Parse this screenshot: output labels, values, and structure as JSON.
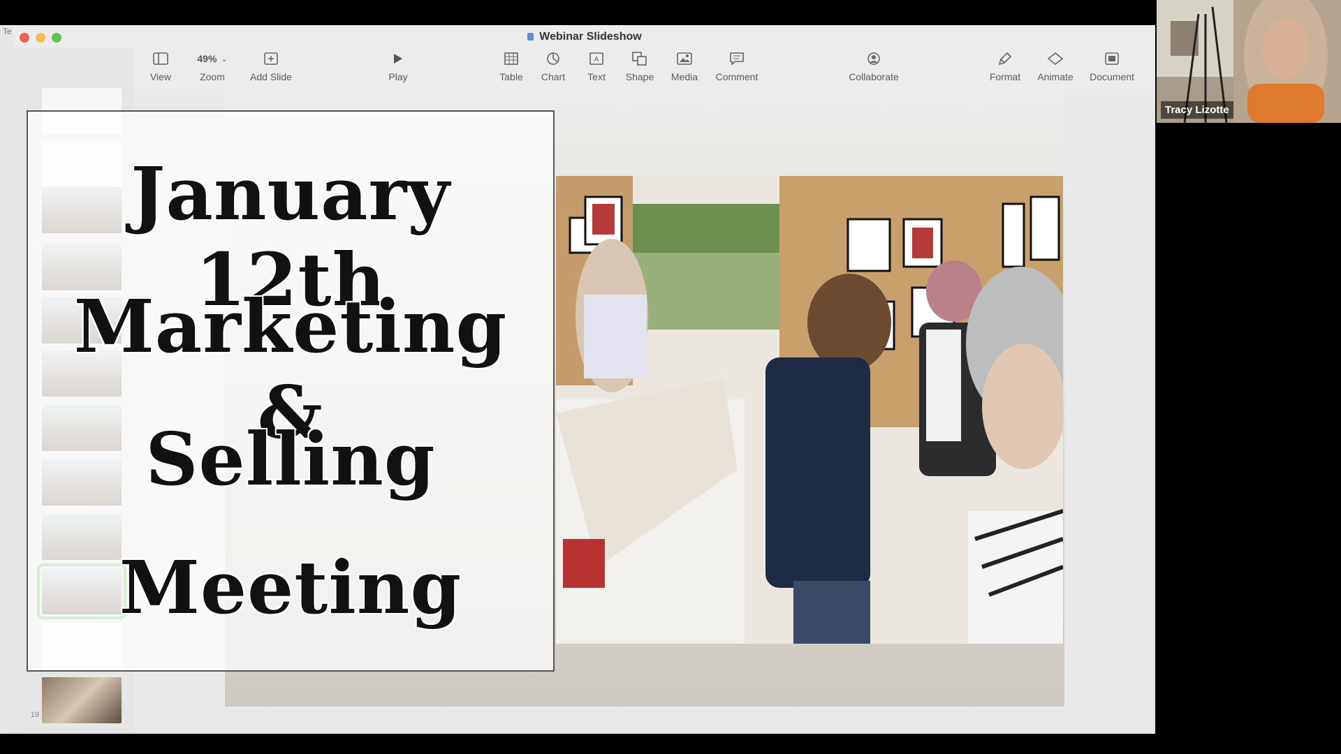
{
  "window": {
    "title": "Webinar Slideshow"
  },
  "background_app": {
    "tab_text": "Te"
  },
  "toolbar": {
    "view": "View",
    "zoom_value": "49%",
    "zoom": "Zoom",
    "add_slide": "Add Slide",
    "play": "Play",
    "table": "Table",
    "chart": "Chart",
    "text": "Text",
    "shape": "Shape",
    "media": "Media",
    "comment": "Comment",
    "collaborate": "Collaborate",
    "format": "Format",
    "animate": "Animate",
    "document": "Document"
  },
  "navigator": {
    "visible_slide_number": "19",
    "selected_slide": "current"
  },
  "slide": {
    "line1": "January 12th",
    "line2": "Marketing &",
    "line3": "Selling",
    "line4": "Meeting"
  },
  "participant": {
    "name": "Tracy Lizotte"
  },
  "colors": {
    "selection_green": "#6fc76a",
    "window_bg": "#ececec"
  }
}
